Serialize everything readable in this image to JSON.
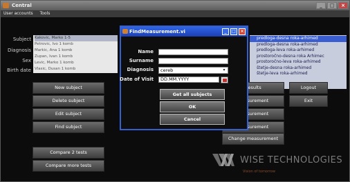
{
  "window": {
    "title": "Central",
    "menu": [
      "User accounts",
      "Tools"
    ]
  },
  "form": {
    "subject_label": "Subject",
    "diagnosis_label": "Diagnosis",
    "sex_label": "Sex",
    "birth_date_label": "Birth date"
  },
  "subjects": [
    "Kakovic, Marko 1-5",
    "Petrovic, Ivo 1 komb",
    "Markic, Ana 1 komb",
    "Zupan, Ivan 1 komb",
    "Levic, Marko 1 komb",
    "Vlasic, Dusan 1 komb"
  ],
  "measurements": [
    "predloga-desna roka-arhimed",
    "predloga-desna roka-arhimed",
    "predloga-leva roka-arhimed",
    "prostoročno-desna roka Arhimec",
    "prostoročno-leva roka-arhimed",
    "štetje-desna roka-arhimed",
    "štetje-leva roka-arhimed"
  ],
  "buttons": {
    "new_subject": "New subject",
    "delete_subject": "Delete subject",
    "edit_subject": "Edit subject",
    "find_subject": "Find subject",
    "compare_two": "Compare 2 tests",
    "compare_more": "Compare more tests",
    "results": "Results",
    "measurement_1": "Measurement",
    "measurement_2": "Measurement",
    "measurement_3": "Measurement",
    "change_measurement": "Change measurement",
    "logout": "Logout",
    "exit": "Exit"
  },
  "logo": {
    "name": "WISE TECHNOLOGIES",
    "tagline": "Vision of tomorrow"
  },
  "dialog": {
    "title": "FindMeasurement.vi",
    "name_label": "Name",
    "surname_label": "Surname",
    "diagnosis_label": "Diagnosis",
    "date_label": "Date of Visit",
    "name_value": "",
    "surname_value": "",
    "diagnosis_value": "cereb",
    "date_value": "DD.MM.YYYY",
    "get_all_label": "Get all subjects",
    "ok_label": "OK",
    "cancel_label": "Cancel"
  },
  "colors": {
    "dialog_accent": "#3560d0",
    "list_selection": "#3a5ed0",
    "titlebar": "#707070"
  }
}
